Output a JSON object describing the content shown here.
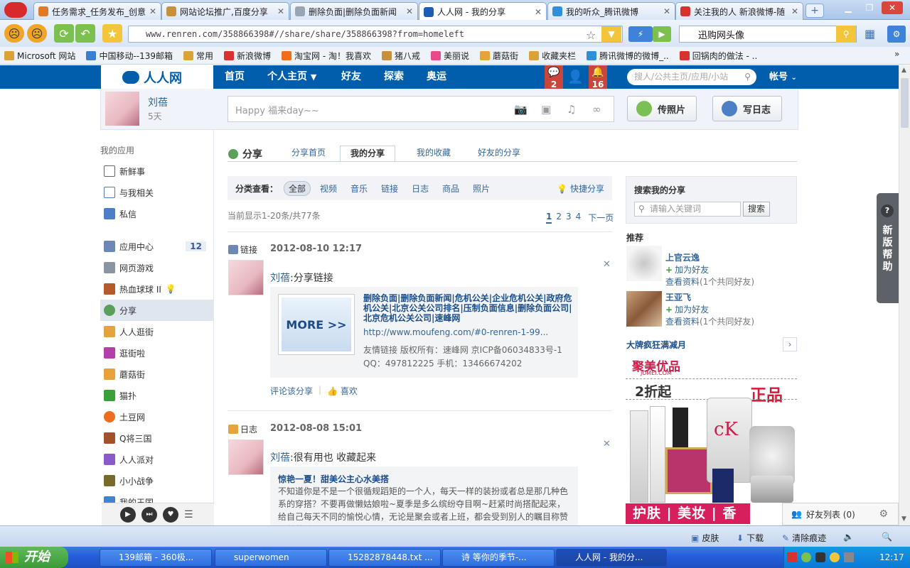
{
  "browser": {
    "tabs": [
      {
        "title": "任务需求_任务发布_创意",
        "color": "#e07a29"
      },
      {
        "title": "网站论坛推广,百度分享",
        "color": "#c6913a"
      },
      {
        "title": "删除负面|删除负面新闻",
        "color": "#9aa5b4"
      },
      {
        "title": "人人网 - 我的分享",
        "color": "#1a5fb4"
      },
      {
        "title": "我的听众_腾讯微博",
        "color": "#2f8fd8"
      },
      {
        "title": "关注我的人 新浪微博-随",
        "color": "#d8322f"
      }
    ],
    "url": "www.renren.com/358866398#//share/share/358866398?from=homeleft",
    "search_text": "迅购网头像",
    "bookmarks": [
      {
        "label": "Microsoft 网站",
        "color": "#d9a33a"
      },
      {
        "label": "中国移动--139邮箱",
        "color": "#3b7fd1"
      },
      {
        "label": "常用",
        "color": "#d9a33a"
      },
      {
        "label": "新浪微博",
        "color": "#d8322f"
      },
      {
        "label": "淘宝网 - 淘！我喜欢",
        "color": "#ef6d1f"
      },
      {
        "label": "猪八戒",
        "color": "#c6913a"
      },
      {
        "label": "美丽说",
        "color": "#e84a8a"
      },
      {
        "label": "蘑菇街",
        "color": "#e8a23a"
      },
      {
        "label": "收藏夹栏",
        "color": "#d9a33a"
      },
      {
        "label": "腾讯微博的微博_..",
        "color": "#2f8fd8"
      },
      {
        "label": "回锅肉的做法 - ..",
        "color": "#d8322f"
      }
    ]
  },
  "renren": {
    "logo": "人人网",
    "nav": {
      "home": "首页",
      "personal": "个人主页",
      "friends": "好友",
      "explore": "探索",
      "olympics": "奥运"
    },
    "notif_messages": "2",
    "notif_alerts": "16",
    "search_placeholder": "搜人/公共主页/应用/小站",
    "account": "帐号"
  },
  "publisher": {
    "user_name": "刘蓓",
    "user_days": "5天",
    "placeholder": "Happy 福来day~~",
    "upload_photo": "传照片",
    "write_blog": "写日志"
  },
  "sidebar": {
    "heading": "我的应用",
    "items": [
      {
        "label": "新鲜事"
      },
      {
        "label": "与我相关"
      },
      {
        "label": "私信"
      },
      {
        "label": "应用中心",
        "badge": "12"
      },
      {
        "label": "网页游戏"
      },
      {
        "label": "热血球球 II"
      },
      {
        "label": "分享"
      },
      {
        "label": "人人逛街"
      },
      {
        "label": "逛街啦"
      },
      {
        "label": "蘑菇街"
      },
      {
        "label": "猫扑"
      },
      {
        "label": "土豆网"
      },
      {
        "label": "Q将三国"
      },
      {
        "label": "人人派对"
      },
      {
        "label": "小小战争"
      },
      {
        "label": "我的王国"
      }
    ]
  },
  "share": {
    "title": "分享",
    "tabs": [
      "分享首页",
      "我的分享",
      "我的收藏",
      "好友的分享"
    ],
    "filter_label": "分类查看：",
    "filters": [
      "全部",
      "视频",
      "音乐",
      "链接",
      "日志",
      "商品",
      "照片"
    ],
    "quick_share": "快捷分享",
    "count_info": "当前显示1-20条/共77条",
    "pages": [
      "1",
      "2",
      "3",
      "4"
    ],
    "next_page": "下一页"
  },
  "feed1": {
    "type": "链接",
    "time": "2012-08-10 12:17",
    "user": "刘蓓",
    "action": ":分享链接",
    "thumb_text": "MORE >>",
    "link_title": "删除负面|删除负面新闻|危机公关|企业危机公关|政府危机公关|北京公关公司排名|压制负面信息|删除负面公司|北京危机公关公司|速峰网",
    "link_url": "http://www.moufeng.com/#0-renren-1-99...",
    "link_desc": "友情链接 版权所有：速峰网 京ICP备06034833号-1 QQ：497812225 手机：13466674202",
    "comment": "评论该分享",
    "like": "喜欢"
  },
  "feed2": {
    "type": "日志",
    "time": "2012-08-08 15:01",
    "user": "刘蓓",
    "action": ":很有用也 收藏起来",
    "blog_title": "惊艳一夏！甜美公主心水美搭",
    "blog_body": "不知道你是不是一个很循规蹈矩的一个人，每天一样的装扮或者总是那几种色系的穿搭？不要再做懒姑娘啦~夏季是多么缤纷夺目啊~赶紧时尚搭配起来，给自己每天不同的愉悦心情，无论是聚会或者上班，都会受到别人的瞩目称赞与羡慕哦..."
  },
  "right": {
    "search_title": "搜索我的分享",
    "search_placeholder": "请输入关键词",
    "search_button": "搜索",
    "recommend_title": "推荐",
    "recommendations": [
      {
        "name": "上官云逸",
        "add": "加为好友",
        "profile": "查看资料",
        "mutual": "(1个共同好友)"
      },
      {
        "name": "王亚飞",
        "add": "加为好友",
        "profile": "查看资料",
        "mutual": "(1个共同好友)"
      }
    ],
    "ad_title": "大牌疯狂满减月",
    "ad_brand": "聚美优品",
    "ad_brand_sub": "JUMEI.COM",
    "ad_discount": "2折起",
    "ad_genuine": "正品",
    "ad_bottom": "护肤 | 美妆 | 香水"
  },
  "help_tab": "新版帮助",
  "friends_bar": "好友列表 (0)",
  "statusbar": {
    "skin": "皮肤",
    "download": "下载",
    "clear": "清除痕迹"
  },
  "taskbar": {
    "start": "开始",
    "tasks": [
      "139邮箱 - 360极...",
      "superwomen",
      "15282878448.txt ...",
      "诗   等你的季节-...",
      "人人网 - 我的分..."
    ],
    "clock": "12:17"
  }
}
